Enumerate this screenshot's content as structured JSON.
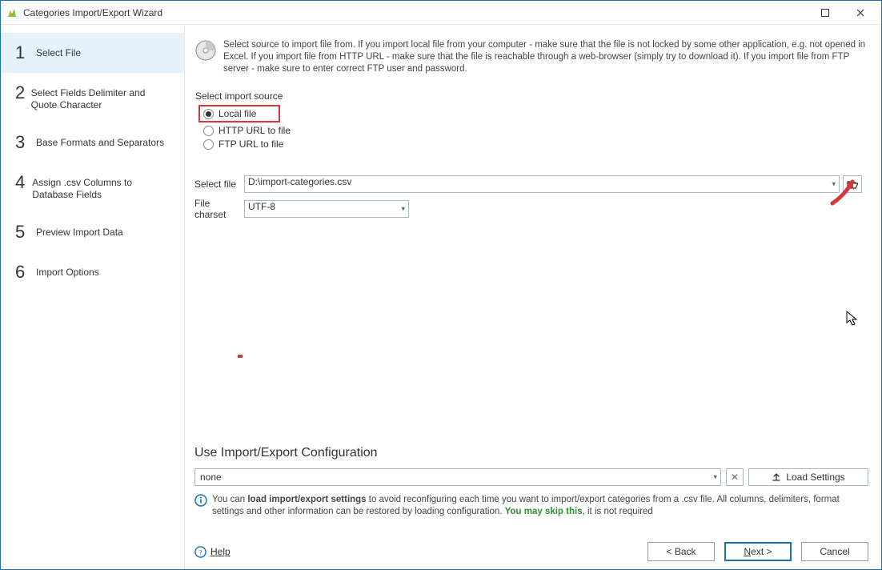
{
  "window": {
    "title": "Categories Import/Export Wizard"
  },
  "steps": [
    {
      "num": "1",
      "label": "Select File",
      "active": true
    },
    {
      "num": "2",
      "label": "Select Fields Delimiter and Quote Character",
      "active": false
    },
    {
      "num": "3",
      "label": "Base Formats and Separators",
      "active": false
    },
    {
      "num": "4",
      "label": "Assign .csv Columns to Database Fields",
      "active": false
    },
    {
      "num": "5",
      "label": "Preview Import Data",
      "active": false
    },
    {
      "num": "6",
      "label": "Import Options",
      "active": false
    }
  ],
  "info_text": "Select source to import file from. If you import local file from your computer - make sure that the file is not locked by some other application, e.g. not opened in Excel. If you import file from HTTP URL - make sure that the file is reachable through a web-browser (simply try to download it). If you import file from FTP server - make sure to enter correct FTP user and password.",
  "source_group": {
    "legend": "Select import source",
    "options": [
      {
        "label": "Local file",
        "checked": true,
        "highlighted": true
      },
      {
        "label": "HTTP URL to file",
        "checked": false,
        "highlighted": false
      },
      {
        "label": "FTP URL to file",
        "checked": false,
        "highlighted": false
      }
    ]
  },
  "select_file": {
    "label": "Select file",
    "value": "D:\\import-categories.csv"
  },
  "file_charset": {
    "label": "File charset",
    "value": "UTF-8"
  },
  "config_section": {
    "title": "Use Import/Export Configuration",
    "value": "none",
    "load_label": "Load Settings",
    "tip_prefix": "You can ",
    "tip_bold": "load import/export settings",
    "tip_middle": " to avoid reconfiguring each time you want to import/export categories from a .csv file. All columns, delimiters, format settings and other information can be restored by loading configuration. ",
    "tip_green": "You may skip this",
    "tip_suffix": ", it is not required"
  },
  "footer": {
    "help": "Help",
    "back": "< Back",
    "next": "Next >",
    "cancel": "Cancel"
  }
}
